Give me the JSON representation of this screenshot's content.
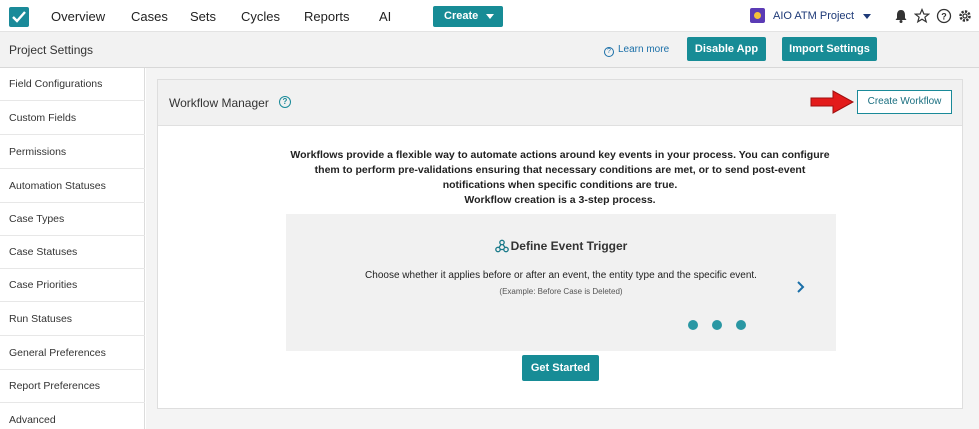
{
  "nav": {
    "items": [
      "Overview",
      "Cases",
      "Sets",
      "Cycles",
      "Reports",
      "AI"
    ],
    "create_label": "Create",
    "project_name": "AIO ATM Project",
    "icons": [
      "bell-icon",
      "star-icon",
      "help-icon",
      "settings-icon"
    ]
  },
  "subheader": {
    "title": "Project Settings",
    "learn_more": "Learn more",
    "disable_app": "Disable App",
    "import_settings": "Import Settings"
  },
  "sidebar": {
    "items": [
      {
        "label": "Field Configurations"
      },
      {
        "label": "Custom Fields"
      },
      {
        "label": "Permissions"
      },
      {
        "label": "Automation Statuses"
      },
      {
        "label": "Case Types"
      },
      {
        "label": "Case Statuses"
      },
      {
        "label": "Case Priorities"
      },
      {
        "label": "Run Statuses"
      },
      {
        "label": "General Preferences"
      },
      {
        "label": "Report Preferences"
      },
      {
        "label": "Advanced"
      }
    ]
  },
  "workflow": {
    "title": "Workflow Manager",
    "create_button": "Create Workflow",
    "intro_lines": [
      "Workflows provide a flexible way to automate actions around key events in your process. You can configure",
      "them to perform pre-validations ensuring that necessary conditions are met, or to send post-event",
      "notifications when specific conditions are true.",
      "Workflow creation is a 3-step process."
    ],
    "step": {
      "title": "Define Event Trigger",
      "description": "Choose whether it applies before or after an event, the entity type and the specific event.",
      "example": "(Example: Before Case is Deleted)"
    },
    "get_started": "Get Started"
  },
  "colors": {
    "accent": "#178c96",
    "arrow": "#e31b1b"
  }
}
